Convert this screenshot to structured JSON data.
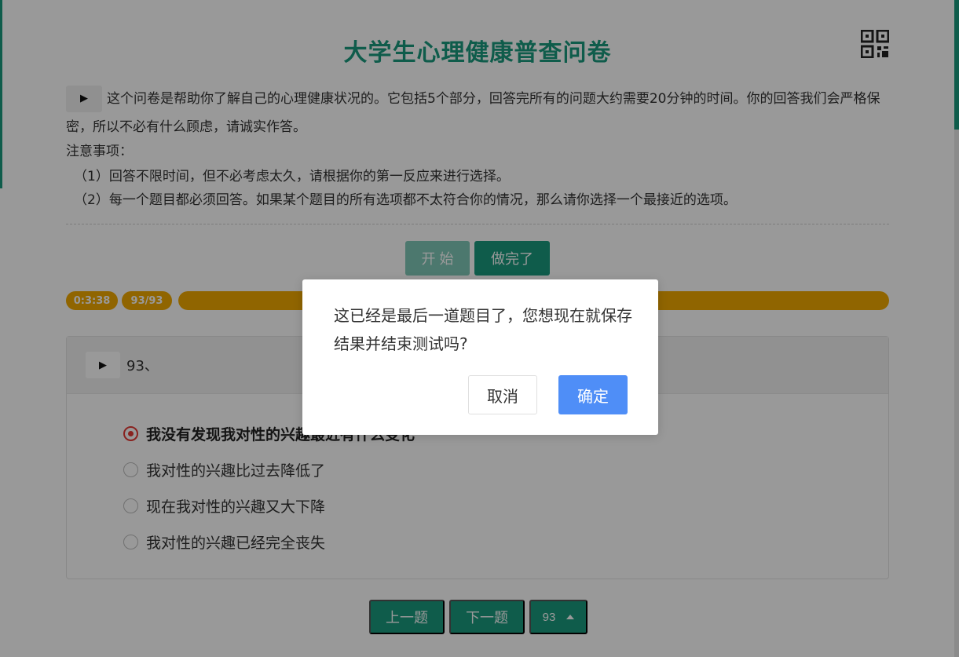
{
  "page": {
    "title": "大学生心理健康普查问卷",
    "intro_text": "这个问卷是帮助你了解自己的心理健康状况的。它包括5个部分，回答完所有的问题大约需要20分钟的时间。你的回答我们会严格保密，所以不必有什么顾虑，请诚实作答。",
    "notes_title": "注意事项：",
    "note_1": "（1）回答不限时间，但不必考虑太久，请根据你的第一反应来进行选择。",
    "note_2": "（2）每一个题目都必须回答。如果某个题目的所有选项都不太符合你的情况，那么请你选择一个最接近的选项。"
  },
  "controls": {
    "start_label": "开 始",
    "done_label": "做完了"
  },
  "progress": {
    "timer": "0:3:38",
    "count": "93/93",
    "fraction": 1.0
  },
  "question": {
    "number": "93、",
    "options": [
      {
        "label": "我没有发现我对性的兴趣最近有什么变化",
        "selected": true
      },
      {
        "label": "我对性的兴趣比过去降低了",
        "selected": false
      },
      {
        "label": "现在我对性的兴趣又大下降",
        "selected": false
      },
      {
        "label": "我对性的兴趣已经完全丧失",
        "selected": false
      }
    ]
  },
  "nav": {
    "prev_label": "上一题",
    "next_label": "下一题",
    "current_number": "93"
  },
  "dialog": {
    "message": "这已经是最后一道题目了，您想现在就保存结果并结束测试吗?",
    "cancel_label": "取消",
    "confirm_label": "确定"
  },
  "colors": {
    "primary": "#1a9a7e",
    "progress": "#f0a800",
    "confirm": "#4f8ef7",
    "selected_radio": "#e53935"
  },
  "icons": {
    "qr": "qr-code-icon",
    "play": "play-icon",
    "caret": "caret-up-icon"
  }
}
